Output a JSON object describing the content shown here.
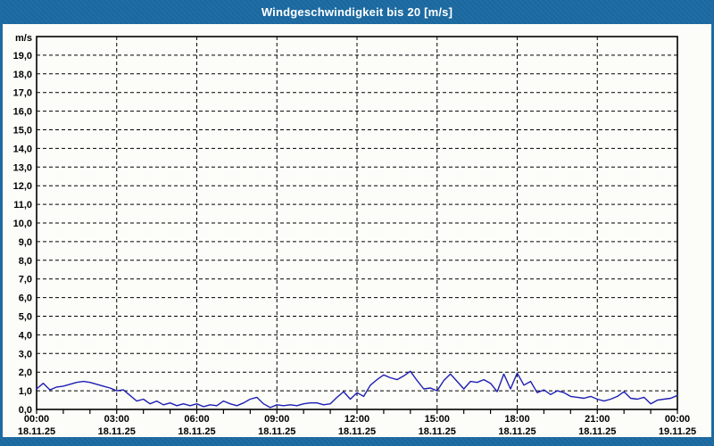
{
  "window": {
    "title": "Windgeschwindigkeit bis 20 [m/s]",
    "colors": {
      "titlebar_bg": "#1c6ba3",
      "titlebar_text": "#ffffff",
      "window_bg": "#fcfdf8",
      "border": "#1c6ba3",
      "frame": "#000000",
      "grid": "#000000",
      "tick": "#000000",
      "axis_text": "#000000",
      "line": "#1e1eb4"
    }
  },
  "chart_data": {
    "type": "line",
    "title": "Windgeschwindigkeit bis 20 [m/s]",
    "xlabel": "",
    "ylabel": "m/s",
    "ylim": [
      0,
      20
    ],
    "ytick_step": 1,
    "ytick_label_max": 19,
    "decimal_separator": ",",
    "xlim_hours": [
      0,
      24
    ],
    "x_minor_tick_hours": 1,
    "grid_hours": [
      3,
      6,
      9,
      12,
      15,
      18,
      21
    ],
    "xticks": [
      {
        "hour": 0,
        "time": "00:00",
        "date": "18.11.25"
      },
      {
        "hour": 3,
        "time": "03:00",
        "date": "18.11.25"
      },
      {
        "hour": 6,
        "time": "06:00",
        "date": "18.11.25"
      },
      {
        "hour": 9,
        "time": "09:00",
        "date": "18.11.25"
      },
      {
        "hour": 12,
        "time": "12:00",
        "date": "18.11.25"
      },
      {
        "hour": 15,
        "time": "15:00",
        "date": "18.11.25"
      },
      {
        "hour": 18,
        "time": "18:00",
        "date": "18.11.25"
      },
      {
        "hour": 21,
        "time": "21:00",
        "date": "18.11.25"
      },
      {
        "hour": 24,
        "time": "00:00",
        "date": "19.11.25"
      }
    ],
    "grid_style": "dashed",
    "legend": null,
    "series": [
      {
        "name": "Windgeschwindigkeit",
        "unit": "m/s",
        "start_hour": 0,
        "step_hours": 0.25,
        "values": [
          1.1,
          1.4,
          1.05,
          1.2,
          1.25,
          1.35,
          1.45,
          1.5,
          1.45,
          1.35,
          1.25,
          1.15,
          1.0,
          1.05,
          0.75,
          0.45,
          0.55,
          0.3,
          0.45,
          0.25,
          0.35,
          0.2,
          0.3,
          0.2,
          0.3,
          0.15,
          0.25,
          0.2,
          0.45,
          0.3,
          0.2,
          0.35,
          0.55,
          0.65,
          0.3,
          0.1,
          0.25,
          0.2,
          0.25,
          0.2,
          0.3,
          0.35,
          0.35,
          0.25,
          0.3,
          0.65,
          0.95,
          0.55,
          0.9,
          0.7,
          1.3,
          1.6,
          1.85,
          1.7,
          1.6,
          1.8,
          2.05,
          1.55,
          1.1,
          1.15,
          1.0,
          1.55,
          1.9,
          1.5,
          1.1,
          1.5,
          1.45,
          1.6,
          1.4,
          0.95,
          1.9,
          1.1,
          1.95,
          1.3,
          1.5,
          0.9,
          1.05,
          0.8,
          1.0,
          0.9,
          0.7,
          0.65,
          0.6,
          0.7,
          0.55,
          0.45,
          0.55,
          0.7,
          0.95,
          0.6,
          0.55,
          0.65,
          0.3,
          0.5,
          0.55,
          0.6,
          0.75
        ]
      }
    ]
  }
}
